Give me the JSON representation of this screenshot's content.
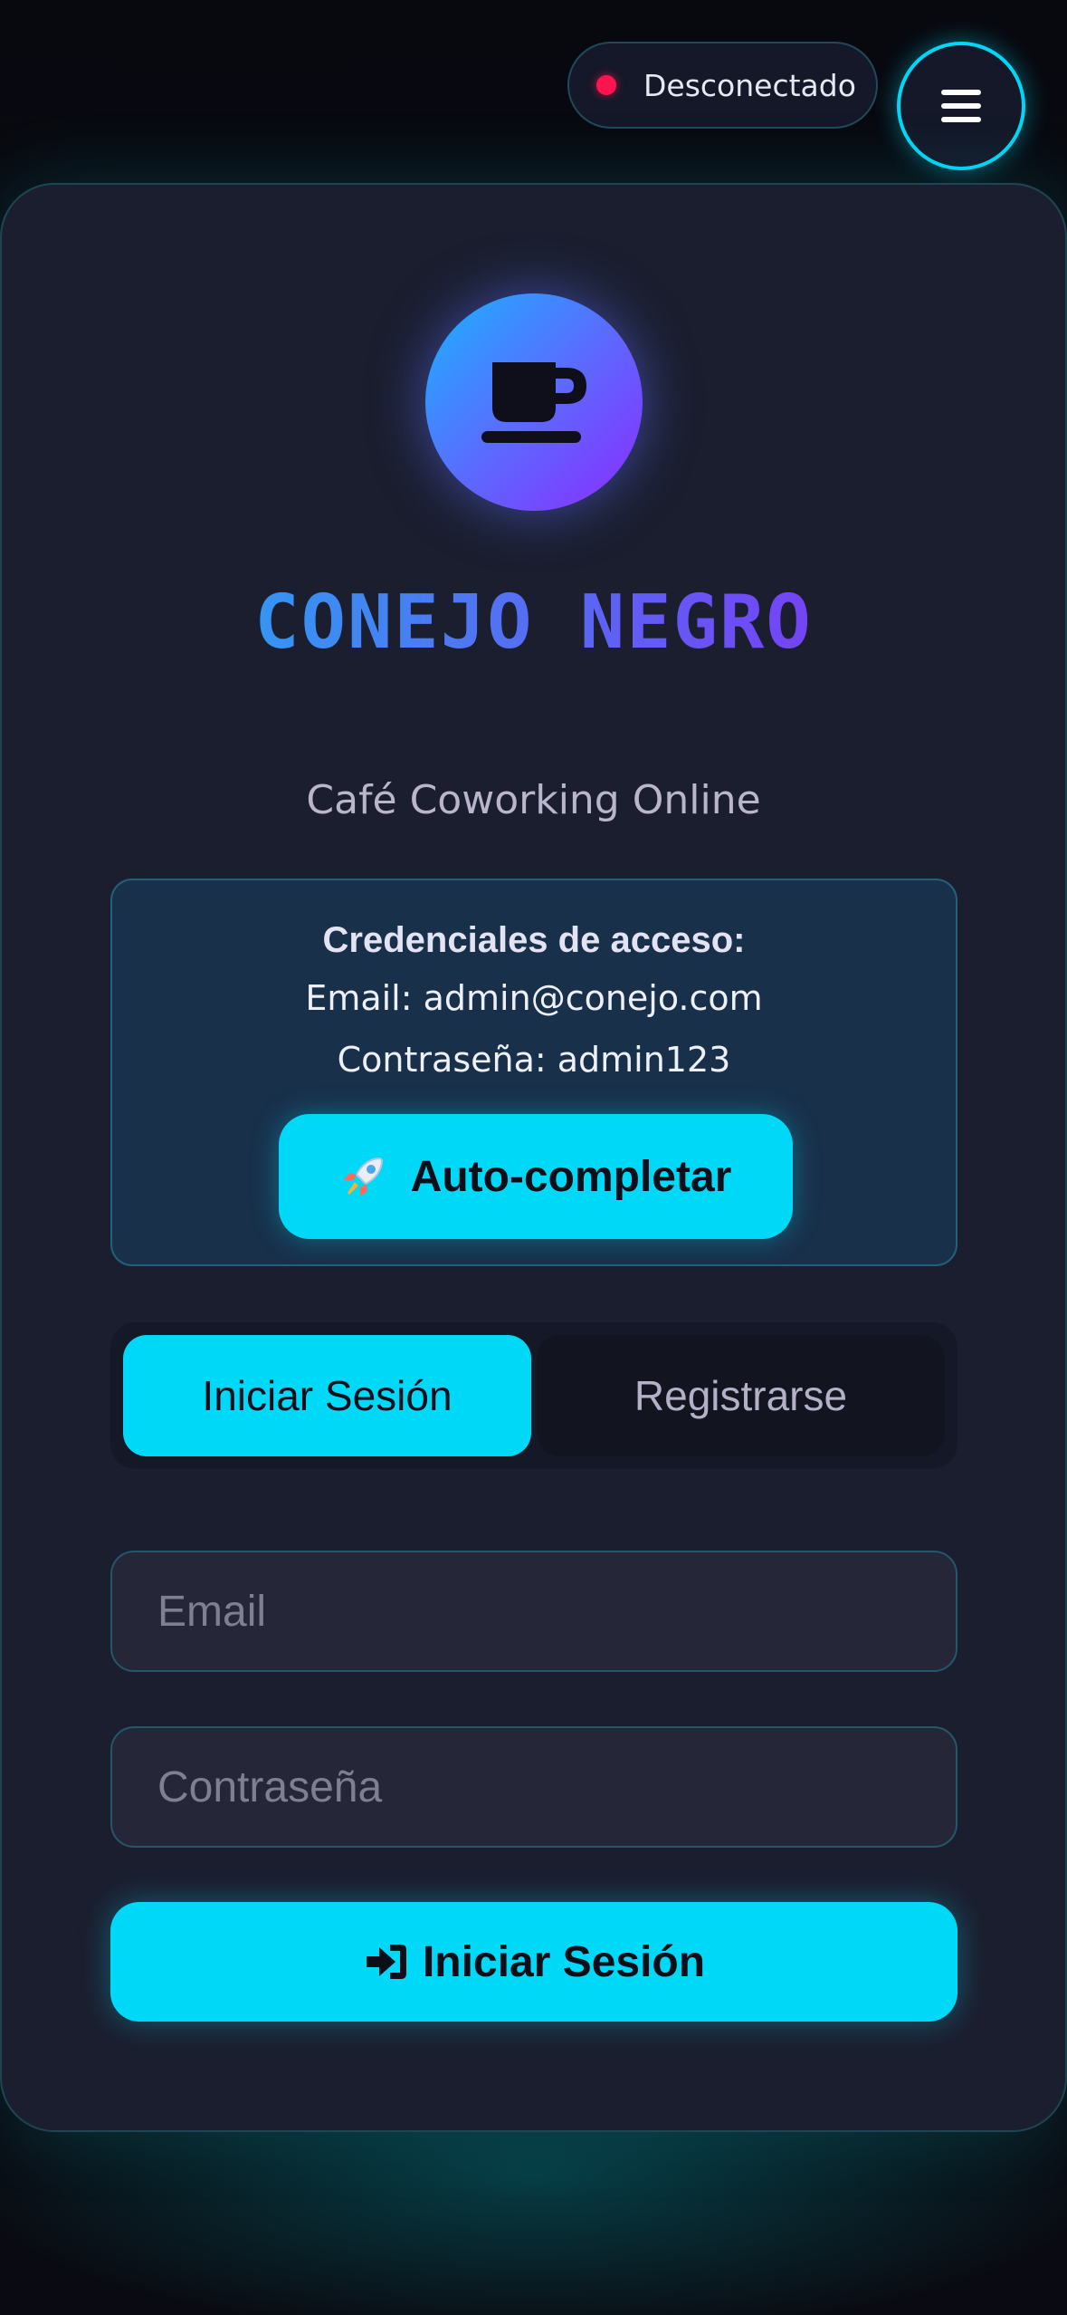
{
  "status": {
    "text": "Desconectado",
    "dot_color": "#ff1450"
  },
  "menu": {
    "icon": "hamburger-menu-icon"
  },
  "brand": {
    "icon": "coffee-cup-icon",
    "title": "CONEJO NEGRO",
    "subtitle": "Café Coworking Online",
    "gradient": [
      "#15b8f5",
      "#4a7df2",
      "#8f22ee"
    ]
  },
  "credentials": {
    "title": "Credenciales de acceso:",
    "email_line": "Email: admin@conejo.com",
    "password_line": "Contraseña: admin123",
    "autofill_icon": "rocket-icon",
    "autofill_label": "Auto-completar"
  },
  "tabs": [
    {
      "label": "Iniciar Sesión",
      "active": true
    },
    {
      "label": "Registrarse",
      "active": false
    }
  ],
  "form": {
    "email": {
      "value": "",
      "placeholder": "Email"
    },
    "password": {
      "value": "",
      "placeholder": "Contraseña"
    },
    "submit_icon": "sign-in-icon",
    "submit_label": "Iniciar Sesión"
  },
  "colors": {
    "accent": "#00d8f8",
    "card_bg": "#1b1e2e",
    "page_bg": "#0a0b12"
  }
}
